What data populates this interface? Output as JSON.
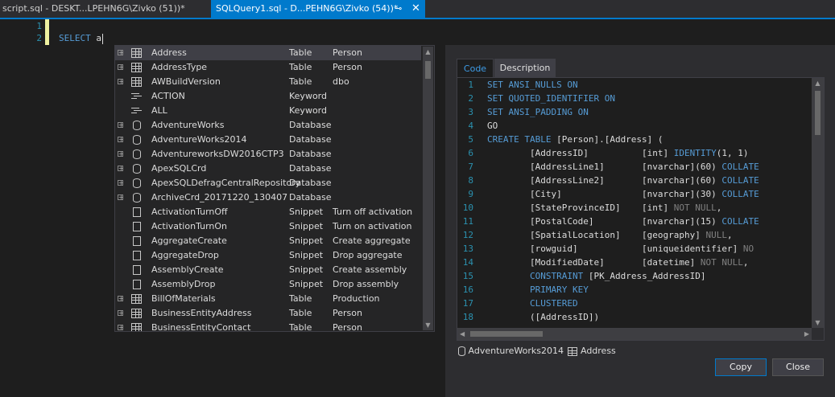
{
  "tabs": [
    {
      "label": "script.sql - DESKT...LPEHN6G\\Zivko (51))*"
    },
    {
      "label": "SQLQuery1.sql - D...PEHN6G\\Zivko (54))*",
      "pin": "⊸",
      "close": "✕"
    }
  ],
  "editor": {
    "line_numbers": [
      "1",
      "2"
    ],
    "keyword": "SELECT",
    "typed": "a"
  },
  "completion": {
    "items": [
      {
        "name": "Address",
        "type": "Table",
        "schema": "Person",
        "icon": "table-icon",
        "expand": "+"
      },
      {
        "name": "AddressType",
        "type": "Table",
        "schema": "Person",
        "icon": "table-icon",
        "expand": "+"
      },
      {
        "name": "AWBuildVersion",
        "type": "Table",
        "schema": "dbo",
        "icon": "table-icon",
        "expand": "+"
      },
      {
        "name": "ACTION",
        "type": "Keyword",
        "schema": "",
        "icon": "keyword-icon",
        "expand": ""
      },
      {
        "name": "ALL",
        "type": "Keyword",
        "schema": "",
        "icon": "keyword-icon",
        "expand": ""
      },
      {
        "name": "AdventureWorks",
        "type": "Database",
        "schema": "",
        "icon": "database-icon",
        "expand": "+"
      },
      {
        "name": "AdventureWorks2014",
        "type": "Database",
        "schema": "",
        "icon": "database-icon",
        "expand": "+"
      },
      {
        "name": "AdventureworksDW2016CTP3",
        "type": "Database",
        "schema": "",
        "icon": "database-icon",
        "expand": "+"
      },
      {
        "name": "ApexSQLCrd",
        "type": "Database",
        "schema": "",
        "icon": "database-icon",
        "expand": "+"
      },
      {
        "name": "ApexSQLDefragCentralRepository",
        "type": "Database",
        "schema": "",
        "icon": "database-icon",
        "expand": "+"
      },
      {
        "name": "ArchiveCrd_20171220_130407",
        "type": "Database",
        "schema": "",
        "icon": "database-icon",
        "expand": "+"
      },
      {
        "name": "ActivationTurnOff",
        "type": "Snippet",
        "schema": "Turn off activation",
        "icon": "snippet-icon",
        "expand": ""
      },
      {
        "name": "ActivationTurnOn",
        "type": "Snippet",
        "schema": "Turn on activation",
        "icon": "snippet-icon",
        "expand": ""
      },
      {
        "name": "AggregateCreate",
        "type": "Snippet",
        "schema": "Create aggregate",
        "icon": "snippet-icon",
        "expand": ""
      },
      {
        "name": "AggregateDrop",
        "type": "Snippet",
        "schema": "Drop aggregate",
        "icon": "snippet-icon",
        "expand": ""
      },
      {
        "name": "AssemblyCreate",
        "type": "Snippet",
        "schema": "Create assembly",
        "icon": "snippet-icon",
        "expand": ""
      },
      {
        "name": "AssemblyDrop",
        "type": "Snippet",
        "schema": "Drop assembly",
        "icon": "snippet-icon",
        "expand": ""
      },
      {
        "name": "BillOfMaterials",
        "type": "Table",
        "schema": "Production",
        "icon": "table-icon",
        "expand": "+"
      },
      {
        "name": "BusinessEntityAddress",
        "type": "Table",
        "schema": "Person",
        "icon": "table-icon",
        "expand": "+"
      },
      {
        "name": "BusinessEntityContact",
        "type": "Table",
        "schema": "Person",
        "icon": "table-icon",
        "expand": "+"
      }
    ]
  },
  "preview": {
    "tab_code": "Code",
    "tab_description": "Description",
    "lines": [
      {
        "n": "1",
        "segs": [
          [
            "k",
            "SET ANSI_NULLS ON"
          ]
        ]
      },
      {
        "n": "2",
        "segs": [
          [
            "k",
            "SET QUOTED_IDENTIFIER ON"
          ]
        ]
      },
      {
        "n": "3",
        "segs": [
          [
            "k",
            "SET ANSI_PADDING ON"
          ]
        ]
      },
      {
        "n": "4",
        "segs": [
          [
            "t",
            "GO"
          ]
        ]
      },
      {
        "n": "5",
        "segs": [
          [
            "k",
            "CREATE TABLE "
          ],
          [
            "t",
            "[Person].[Address] ("
          ]
        ]
      },
      {
        "n": "6",
        "segs": [
          [
            "t",
            "        [AddressID]          [int] "
          ],
          [
            "k",
            "IDENTITY"
          ],
          [
            "t",
            "(1, 1)"
          ]
        ]
      },
      {
        "n": "7",
        "segs": [
          [
            "t",
            "        [AddressLine1]       [nvarchar](60) "
          ],
          [
            "k",
            "COLLATE"
          ]
        ]
      },
      {
        "n": "8",
        "segs": [
          [
            "t",
            "        [AddressLine2]       [nvarchar](60) "
          ],
          [
            "k",
            "COLLATE"
          ]
        ]
      },
      {
        "n": "9",
        "segs": [
          [
            "t",
            "        [City]               [nvarchar](30) "
          ],
          [
            "k",
            "COLLATE"
          ]
        ]
      },
      {
        "n": "10",
        "segs": [
          [
            "t",
            "        [StateProvinceID]    [int] "
          ],
          [
            "g",
            "NOT NULL"
          ],
          [
            "t",
            ","
          ]
        ]
      },
      {
        "n": "11",
        "segs": [
          [
            "t",
            "        [PostalCode]         [nvarchar](15) "
          ],
          [
            "k",
            "COLLATE"
          ]
        ]
      },
      {
        "n": "12",
        "segs": [
          [
            "t",
            "        [SpatialLocation]    [geography] "
          ],
          [
            "g",
            "NULL"
          ],
          [
            "t",
            ","
          ]
        ]
      },
      {
        "n": "13",
        "segs": [
          [
            "t",
            "        [rowguid]            [uniqueidentifier] "
          ],
          [
            "g",
            "NO"
          ]
        ]
      },
      {
        "n": "14",
        "segs": [
          [
            "t",
            "        [ModifiedDate]       [datetime] "
          ],
          [
            "g",
            "NOT NULL"
          ],
          [
            "t",
            ","
          ]
        ]
      },
      {
        "n": "15",
        "segs": [
          [
            "k",
            "        CONSTRAINT "
          ],
          [
            "t",
            "[PK_Address_AddressID]"
          ]
        ]
      },
      {
        "n": "16",
        "segs": [
          [
            "k",
            "        PRIMARY KEY"
          ]
        ]
      },
      {
        "n": "17",
        "segs": [
          [
            "k",
            "        CLUSTERED"
          ]
        ]
      },
      {
        "n": "18",
        "segs": [
          [
            "t",
            "        ([AddressID])"
          ]
        ]
      }
    ],
    "status_db": "AdventureWorks2014",
    "status_obj": "Address",
    "copy_label": "Copy",
    "close_label": "Close"
  },
  "colors": {
    "accent": "#007acc",
    "keyword": "#569cd6",
    "line_number": "#2b91af"
  }
}
